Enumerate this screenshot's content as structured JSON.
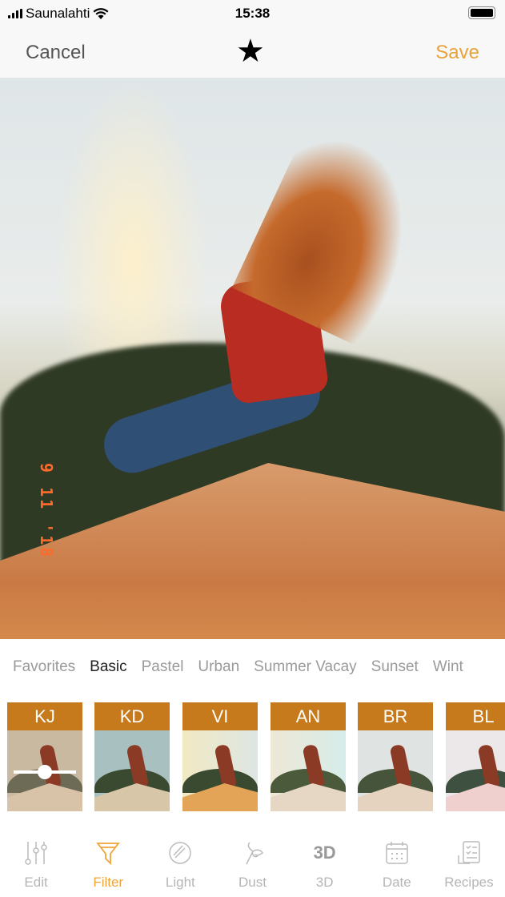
{
  "status": {
    "carrier": "Saunalahti",
    "time": "15:38"
  },
  "nav": {
    "cancel": "Cancel",
    "save": "Save",
    "favorite_icon": "star-icon"
  },
  "photo": {
    "date_stamp": "9 11 '18"
  },
  "categories": [
    "Favorites",
    "Basic",
    "Pastel",
    "Urban",
    "Summer Vacay",
    "Sunset",
    "Wint"
  ],
  "active_category": "Basic",
  "filters": [
    {
      "code": "KJ",
      "selected": true
    },
    {
      "code": "KD"
    },
    {
      "code": "VI"
    },
    {
      "code": "AN"
    },
    {
      "code": "BR"
    },
    {
      "code": "BL"
    }
  ],
  "tabs": [
    {
      "label": "Edit",
      "icon": "sliders-icon"
    },
    {
      "label": "Filter",
      "icon": "funnel-icon",
      "active": true
    },
    {
      "label": "Light",
      "icon": "lens-icon"
    },
    {
      "label": "Dust",
      "icon": "dust-icon"
    },
    {
      "label": "3D",
      "icon": "3D"
    },
    {
      "label": "Date",
      "icon": "calendar-icon"
    },
    {
      "label": "Recipes",
      "icon": "recipe-icon"
    }
  ],
  "colors": {
    "accent": "#e8a23a",
    "filter_label_bg": "#c77a1c"
  }
}
